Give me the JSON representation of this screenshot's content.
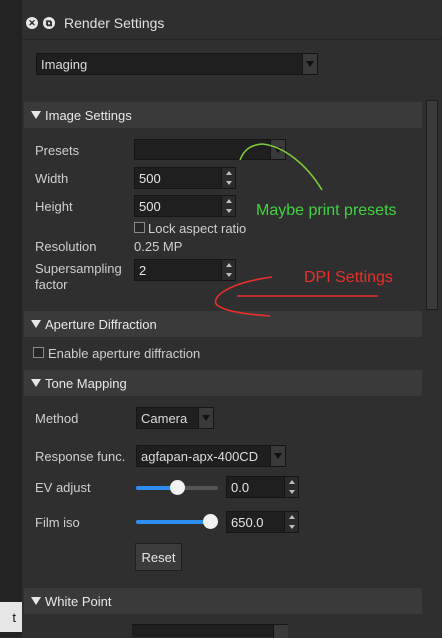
{
  "window": {
    "title": "Render Settings"
  },
  "left_partial_button": "t",
  "mode_select": {
    "value": "Imaging"
  },
  "sections": {
    "image_settings": "Image Settings",
    "aperture": "Aperture Diffraction",
    "tone_mapping": "Tone Mapping",
    "white_point": "White Point"
  },
  "image_settings": {
    "presets_label": "Presets",
    "presets_value": "",
    "width_label": "Width",
    "width_value": "500",
    "height_label": "Height",
    "height_value": "500",
    "lock_aspect_label": "Lock aspect ratio",
    "lock_aspect_checked": false,
    "resolution_label": "Resolution",
    "resolution_value": "0.25 MP",
    "supersampling_label_1": "Supersampling",
    "supersampling_label_2": "factor",
    "supersampling_value": "2"
  },
  "aperture": {
    "enable_label": "Enable aperture diffraction",
    "enable_checked": false
  },
  "tone_mapping": {
    "method_label": "Method",
    "method_value": "Camera",
    "response_label": "Response func.",
    "response_value": "agfapan-apx-400CD",
    "ev_label": "EV adjust",
    "ev_value": "0.0",
    "ev_slider_fraction": 0.5,
    "iso_label": "Film iso",
    "iso_value": "650.0",
    "iso_slider_fraction": 1.0,
    "reset_label": "Reset"
  },
  "annotations": {
    "presets_note": "Maybe print presets",
    "presets_note_color": "#3fd43f",
    "dpi_note": "DPI Settings",
    "dpi_note_color": "#e8302a"
  },
  "colors": {
    "accent": "#2f8ef2",
    "background": "#2f2f2f",
    "section_header": "#3a3a3a"
  }
}
